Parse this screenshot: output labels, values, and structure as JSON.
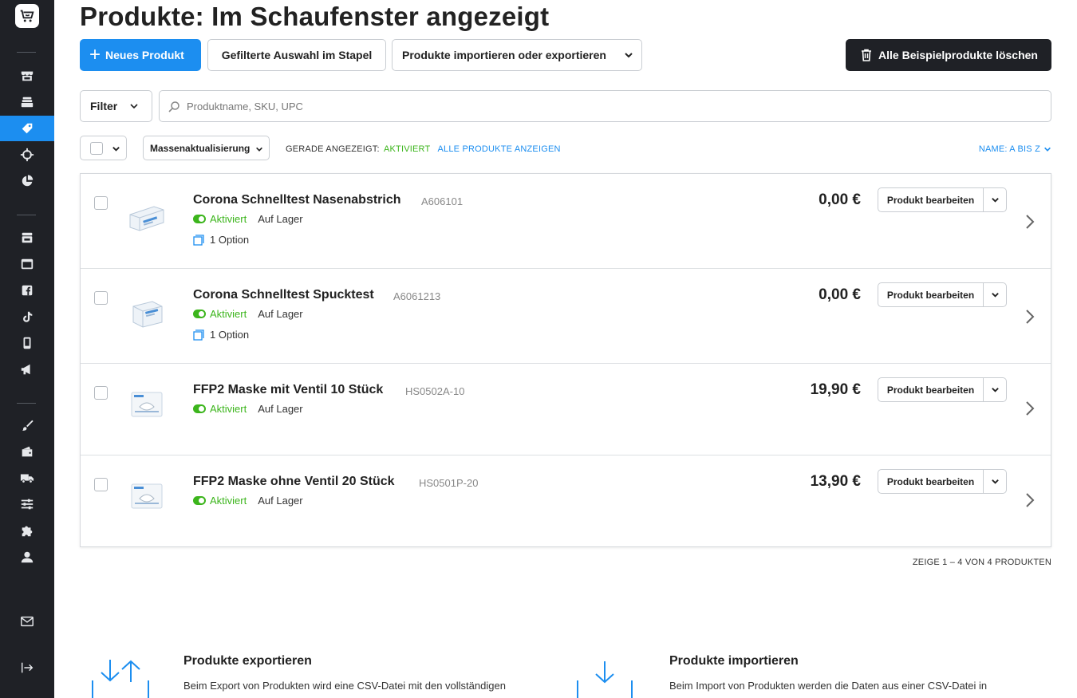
{
  "page": {
    "title": "Produkte: Im Schaufenster angezeigt"
  },
  "toolbar": {
    "new_product": "Neues Produkt",
    "batch": "Gefilterte Auswahl im Stapel",
    "import_export": "Produkte importieren oder exportieren",
    "delete_samples": "Alle Beispielprodukte löschen"
  },
  "search": {
    "filter_label": "Filter",
    "placeholder": "Produktname, SKU, UPC"
  },
  "list_controls": {
    "mass_update": "Massenaktualisierung",
    "currently_shown_label": "GERADE ANGEZEIGT:",
    "currently_shown_value": "AKTIVIERT",
    "show_all": "ALLE PRODUKTE ANZEIGEN",
    "sort": "NAME: A BIS Z"
  },
  "products": [
    {
      "name": "Corona Schnelltest Nasenabstrich",
      "sku": "A606101",
      "status": "Aktiviert",
      "stock": "Auf Lager",
      "option": "1 Option",
      "price": "0,00 €",
      "edit": "Produkt bearbeiten"
    },
    {
      "name": "Corona Schnelltest Spucktest",
      "sku": "A6061213",
      "status": "Aktiviert",
      "stock": "Auf Lager",
      "option": "1 Option",
      "price": "0,00 €",
      "edit": "Produkt bearbeiten"
    },
    {
      "name": "FFP2 Maske mit Ventil 10 Stück",
      "sku": "HS0502A-10",
      "status": "Aktiviert",
      "stock": "Auf Lager",
      "option": "",
      "price": "19,90 €",
      "edit": "Produkt bearbeiten"
    },
    {
      "name": "FFP2 Maske ohne Ventil 20 Stück",
      "sku": "HS0501P-20",
      "status": "Aktiviert",
      "stock": "Auf Lager",
      "option": "",
      "price": "13,90 €",
      "edit": "Produkt bearbeiten"
    }
  ],
  "pagination": "ZEIGE 1 – 4 VON 4 PRODUKTEN",
  "export": {
    "title": "Produkte exportieren",
    "text": "Beim Export von Produkten wird eine CSV-Datei mit den vollständigen"
  },
  "import": {
    "title": "Produkte importieren",
    "text": "Beim Import von Produkten werden die Daten aus einer CSV-Datei in"
  },
  "sidebar": {
    "items": [
      "store-icon",
      "catalog-icon",
      "products-tag-icon",
      "target-icon",
      "reports-pie-icon",
      "shop-icon",
      "browser-icon",
      "facebook-icon",
      "tiktok-icon",
      "mobile-icon",
      "marketing-icon",
      "design-brush-icon",
      "wallet-icon",
      "shipping-truck-icon",
      "settings-sliders-icon",
      "apps-puzzle-icon",
      "account-icon",
      "mail-icon",
      "collapse-icon"
    ]
  },
  "colors": {
    "accent": "#1c8ef0",
    "sidebar": "#1f2126",
    "status_green": "#3cb51c"
  }
}
